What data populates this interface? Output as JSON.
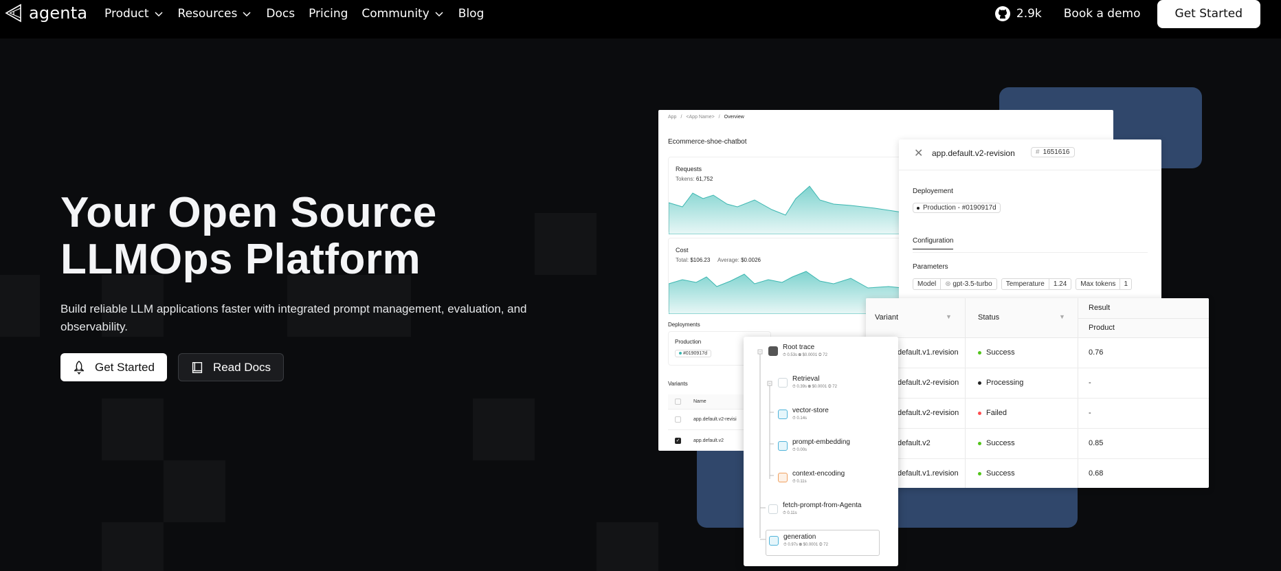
{
  "nav": {
    "brand": "agenta",
    "links": [
      {
        "label": "Product",
        "dropdown": true
      },
      {
        "label": "Resources",
        "dropdown": true
      },
      {
        "label": "Docs",
        "dropdown": false
      },
      {
        "label": "Pricing",
        "dropdown": false
      },
      {
        "label": "Community",
        "dropdown": true
      },
      {
        "label": "Blog",
        "dropdown": false
      }
    ],
    "github_stars": "2.9k",
    "book_demo": "Book a demo",
    "get_started": "Get Started"
  },
  "hero": {
    "title_line1": "Your Open Source",
    "title_line2": "LLMOps Platform",
    "subtitle": "Build reliable LLM applications faster with integrated prompt management, evaluation, and observability.",
    "primary_cta": "Get Started",
    "secondary_cta": "Read Docs"
  },
  "mock": {
    "breadcrumb": [
      "App",
      "<App Name>",
      "Overview"
    ],
    "app_name": "Ecommerce-shoe-chatbot",
    "requests": {
      "label": "Requests",
      "tokens_label": "Tokens:",
      "tokens": "61,752"
    },
    "cost": {
      "label": "Cost",
      "total_label": "Total:",
      "total": "$106.23",
      "avg_label": "Average:",
      "avg": "$0.0026"
    },
    "deployments": {
      "label": "Deployments",
      "env": "Production",
      "id": "#0190917d"
    },
    "variants": {
      "label": "Variants",
      "col_name": "Name",
      "rows": [
        "app.default.v2-revisi",
        "app.default.v2"
      ]
    },
    "revision": {
      "title": "app.default.v2-revision",
      "id": "1651616",
      "deployment_label": "Deployement",
      "deployment_value": "Production - #0190917d",
      "tab": "Configuration",
      "params_label": "Parameters",
      "model_label": "Model",
      "model_value": "gpt-3.5-turbo",
      "temp_label": "Temperature",
      "temp_value": "1.24",
      "max_tokens_label": "Max tokens",
      "max_tokens_value": "1"
    },
    "runs": {
      "col_variant": "Variant",
      "col_status": "Status",
      "col_result": "Result",
      "col_product": "Product",
      "rows": [
        {
          "variant": "default.v1.revision",
          "status": "Success",
          "color": "#52c41a",
          "result": "0.76"
        },
        {
          "variant": "default.v2-revision",
          "status": "Processing",
          "color": "#222222",
          "result": "-"
        },
        {
          "variant": "default.v2-revision",
          "status": "Failed",
          "color": "#ff4d4f",
          "result": "-"
        },
        {
          "variant": "default.v2",
          "status": "Success",
          "color": "#52c41a",
          "result": "0.85"
        },
        {
          "variant": "default.v1.revision",
          "status": "Success",
          "color": "#52c41a",
          "result": "0.68"
        }
      ]
    },
    "trace": {
      "nodes": [
        {
          "name": "Root trace",
          "meta": "⏱ 0.53s  ⛁ $0.0001  ◎ 72"
        },
        {
          "name": "Retrieval",
          "meta": "⏱ 0.39s  ⛁ $0.0001  ◎ 72"
        },
        {
          "name": "vector-store",
          "meta": "⏱ 0.14s"
        },
        {
          "name": "prompt-embedding",
          "meta": "⏱ 0.00s"
        },
        {
          "name": "context-encoding",
          "meta": "⏱ 0.11s"
        },
        {
          "name": "fetch-prompt-from-Agenta",
          "meta": "⏱ 0.11s"
        },
        {
          "name": "generation",
          "meta": "⏱ 0.97s  ⛁ $0.0001  ◎ 72"
        }
      ]
    }
  }
}
